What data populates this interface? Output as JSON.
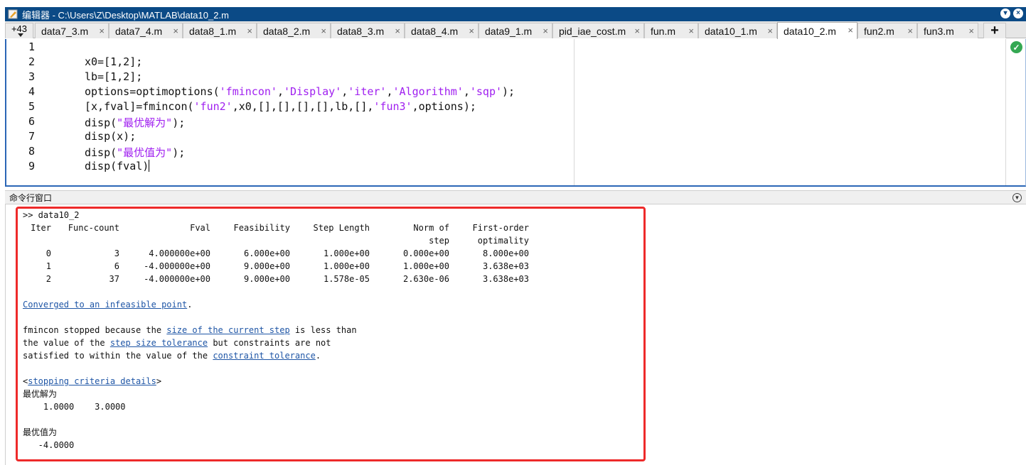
{
  "window": {
    "title": "编辑器 - C:\\Users\\Z\\Desktop\\MATLAB\\data10_2.m"
  },
  "tabs": {
    "more_label": "+43",
    "items": [
      {
        "label": "data7_3.m"
      },
      {
        "label": "data7_4.m"
      },
      {
        "label": "data8_1.m"
      },
      {
        "label": "data8_2.m"
      },
      {
        "label": "data8_3.m"
      },
      {
        "label": "data8_4.m"
      },
      {
        "label": "data9_1.m"
      },
      {
        "label": "pid_iae_cost.m"
      },
      {
        "label": "fun.m"
      },
      {
        "label": "data10_1.m"
      },
      {
        "label": "data10_2.m",
        "active": true
      },
      {
        "label": "fun2.m"
      },
      {
        "label": "fun3.m"
      }
    ],
    "close_glyph": "×",
    "add_label": "+"
  },
  "editor": {
    "line_numbers": [
      "1",
      "2",
      "3",
      "4",
      "5",
      "6",
      "7",
      "8",
      "9"
    ],
    "lines": [
      [],
      [
        {
          "t": "x0=[1,2];"
        }
      ],
      [
        {
          "t": "lb=[1,2];"
        }
      ],
      [
        {
          "t": "options=optimoptions("
        },
        {
          "t": "'fmincon'",
          "s": true
        },
        {
          "t": ","
        },
        {
          "t": "'Display'",
          "s": true
        },
        {
          "t": ","
        },
        {
          "t": "'iter'",
          "s": true
        },
        {
          "t": ","
        },
        {
          "t": "'Algorithm'",
          "s": true
        },
        {
          "t": ","
        },
        {
          "t": "'sqp'",
          "s": true
        },
        {
          "t": ");"
        }
      ],
      [
        {
          "t": "[x,fval]=fmincon("
        },
        {
          "t": "'fun2'",
          "s": true
        },
        {
          "t": ",x0,[],[],[],[],lb,[],"
        },
        {
          "t": "'fun3'",
          "s": true
        },
        {
          "t": ",options);"
        }
      ],
      [
        {
          "t": "disp("
        },
        {
          "t": "\"最优解为\"",
          "s": true
        },
        {
          "t": ");"
        }
      ],
      [
        {
          "t": "disp(x);"
        }
      ],
      [
        {
          "t": "disp("
        },
        {
          "t": "\"最优值为\"",
          "s": true
        },
        {
          "t": ");"
        }
      ],
      [
        {
          "t": "disp(fval)"
        }
      ]
    ],
    "colors": {
      "string": "#a020f0",
      "text": "#111111"
    }
  },
  "command_window": {
    "title": "命令行窗口",
    "prompt_line": ">> data10_2",
    "table": {
      "header1": [
        "Iter",
        "Func-count",
        "Fval",
        "Feasibility",
        "Step Length",
        "Norm of",
        "First-order"
      ],
      "header2": [
        "",
        "",
        "",
        "",
        "",
        "step",
        "optimality"
      ],
      "rows": [
        [
          "0",
          "3",
          "4.000000e+00",
          "6.000e+00",
          "1.000e+00",
          "0.000e+00",
          "8.000e+00"
        ],
        [
          "1",
          "6",
          "-4.000000e+00",
          "9.000e+00",
          "1.000e+00",
          "1.000e+00",
          "3.638e+03"
        ],
        [
          "2",
          "37",
          "-4.000000e+00",
          "9.000e+00",
          "1.578e-05",
          "2.630e-06",
          "3.638e+03"
        ]
      ]
    },
    "converged_link": "Converged to an infeasible point",
    "converged_end": ".",
    "msg": {
      "l1_a": "fmincon stopped because the ",
      "l1_link": "size of the current step",
      "l1_b": " is less than",
      "l2_a": "the value of the ",
      "l2_link": "step size tolerance",
      "l2_b": " but constraints are not",
      "l3_a": "satisfied to within the value of the ",
      "l3_link": "constraint tolerance",
      "l3_b": "."
    },
    "criteria_open": "<",
    "criteria_link": "stopping criteria details",
    "criteria_close": ">",
    "opt_sol_label": "最优解为",
    "opt_sol_values": "    1.0000    3.0000",
    "opt_val_label": "最优值为",
    "opt_val_value": "   -4.0000",
    "link_color": "#1f56a6"
  }
}
